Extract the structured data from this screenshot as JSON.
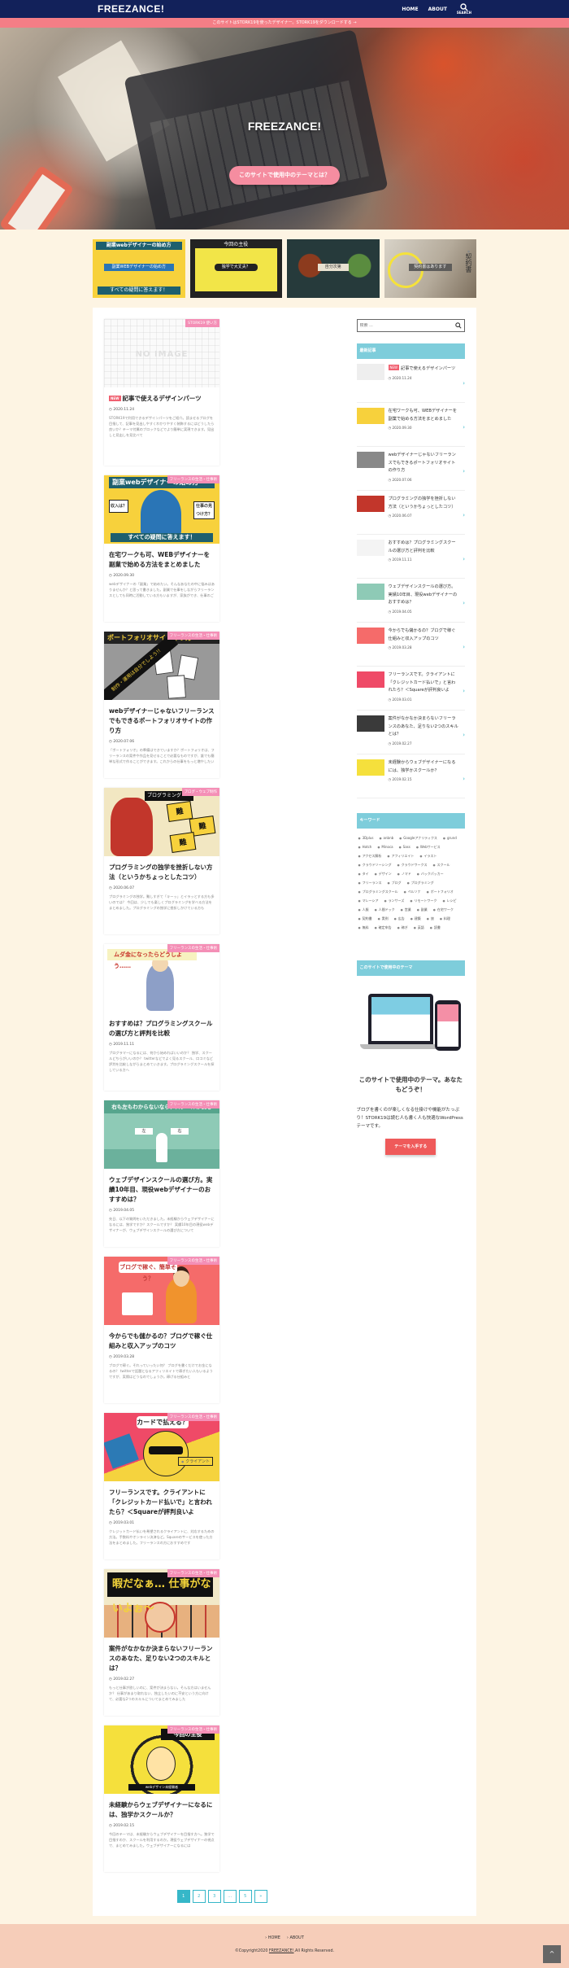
{
  "header": {
    "logo": "FREEZANCE!",
    "nav": [
      "HOME",
      "ABOUT"
    ],
    "search_label": "SEARCH"
  },
  "info_bar": "このサイトはSTORK19を使ったデザイナー。STORK19をダウンロードする →",
  "hero": {
    "title": "FREEZANCE!",
    "button": "このサイトで使用中のテーマとは？"
  },
  "pickup": [
    {
      "line1": "副業webデザイナーの始め方",
      "line2": "副業WEBデザイナーの始め方",
      "line3": "すべての疑問に答えます！"
    },
    {
      "top": "今回の主役",
      "mid": "独学で大丈夫？"
    },
    {
      "mid": "自分次第"
    },
    {
      "mid": "契約書はあります",
      "tag": "契約書"
    }
  ],
  "posts": [
    {
      "category": "STORK19 使い方",
      "new": "NEW",
      "title": "記事で使えるデザインパーツ",
      "date": "2020.11.24",
      "excerpt": "STORK19で利用できるデザインパーツをご紹介。読ませるブログを目指して、記事を見出しやすくわかりやすく装飾するにはどうしたら良いか？テーマ付属のブロックなどでより簡単に実現できます。見出しと見出しを見比べて",
      "thumb_text": "NO IMAGE"
    },
    {
      "category": "フリーランスの生活・仕事術",
      "title": "在宅ワークも可、WEBデザイナーを副業で始める方法をまとめました",
      "date": "2020.09.30",
      "excerpt": "webデザイナーの「副業」で始めたい。そんなあなたの中に悩みはありませんか？と思って書きました。副業で仕事をしながらフリーランスとしても同時に活動している方もいますが、家族ができ、仕事のご",
      "thumb_strip": "副業webデザイナーの始め方",
      "thumb_b1": "収入は？",
      "thumb_b2": "仕事の見つけ方？",
      "thumb_bot": "すべての疑問に答えます！"
    },
    {
      "category": "フリーランスの生活・仕事術",
      "title": "webデザイナーじゃないフリーランスでもできるポートフォリオサイトの作り方",
      "date": "2020.07.06",
      "excerpt": "「ポートフォリオ」の準備はできていますか？ポートフォリオは、フリーランスの案件や作品を見せることで必要なものですが、誰でも簡単な形式で作ることができます。これからの仕事をもっと増やしたい",
      "thumb_strip": "ポートフォリオサイト作り方",
      "thumb_diag": "制作・運用は自分でしよう!!"
    },
    {
      "category": "ブログ・ウェブ制作",
      "title": "プログラミングの独学を挫折しない方法（というかちょっとしたコツ）",
      "date": "2020.06.07",
      "excerpt": "プログラミングの独学。難しすぎて「キーッ」とイラッとする方も多いのでは？ 今回は、少しでも楽しくプログラミングを学べる方法をまとめました。プログラミングの独学に挫折しかけている方も",
      "thumb_strip": "プログラミング",
      "burst": [
        "難",
        "難",
        "難"
      ]
    },
    {
      "category": "フリーランスの生活・仕事術",
      "title": "おすすめは？プログラミングスクールの選び方と評判を比較",
      "date": "2019.11.11",
      "excerpt": "プログラマーになるには、何から始めればいいのか？ 独学、スクールどちらがいいのか？ twitterなどでよく見るスクール、口コミなど評判を比較しながらまとめていきます。プログラミングスクールを探している方へ",
      "thumb_strip": "ムダ金になったらどうしよう……"
    },
    {
      "category": "フリーランスの生活・仕事術",
      "title": "ウェブデザインスクールの選び方。実績10年目、現役webデザイナーのおすすめは？",
      "date": "2019.04.05",
      "excerpt": "先日、以下の質問をいただきました。未経験からウェブデザイナーになるには、独学ですか？スクールですか？ 実績10年目の現役webデザイナーが、ウェブデザインスクールの選び方について",
      "thumb_strip": "右も左もわからないなら、スクールが安心",
      "sign1": "左",
      "sign2": "右"
    },
    {
      "category": "フリーランスの生活・仕事術",
      "title": "今からでも儲かるの？ブログで稼ぐ仕組みと収入アップのコツ",
      "date": "2019.03.28",
      "excerpt": "ブログで稼ぐ。それっていったい何？ ブログを書くだけでお金になるの？ twitterで話題となるアフィリエイトで稼ぎたい人もいるようですが、実際はどうなのでしょうか。稼げる仕組みと",
      "thumb_strip": "ブログで稼ぐ、簡単そう？"
    },
    {
      "category": "フリーランスの生活・仕事術",
      "title": "フリーランスです。クライアントに「クレジットカード払いで」と言われたら？＜Squareが評判良いよ",
      "date": "2019.03.01",
      "excerpt": "クレジットカード払いを希望されるクライアントに、対応するための方法。手数料やオンライン決済など。Squareのサービスを使った方法をまとめました。フリーランスの方におすすめです",
      "thumb_strip": "カードで払える？",
      "thumb_tag": "クライアント"
    },
    {
      "category": "フリーランスの生活・仕事術",
      "title": "案件がなかなか決まらないフリーランスのあなた、足りない2つのスキルとは？",
      "date": "2019.02.27",
      "excerpt": "もっと仕事が欲しいのに、案件が決まらない。そんな方はいませんか？ 仕事があまり取れない、独立したいのに不安という方に向けて、必要な2つのスキルについてまとめてみました",
      "thumb_strip": "暇だなぁ… 仕事がないよぉ～"
    },
    {
      "category": "フリーランスの生活・仕事術",
      "title": "未経験からウェブデザイナーになるには、独学かスクールか？",
      "date": "2019.02.15",
      "excerpt": "今回のテーマは、未経験からウェブデザイナーを目指す方へ。独学で目指すのか、スクールを利用するのか。現役ウェブデザイナーの視点で、まとめてみました。ウェブデザイナーになるには",
      "thumb_strip": "今回の主役",
      "thumb_bar": "webデザイン未経験者"
    }
  ],
  "pagination": [
    "1",
    "2",
    "3",
    "…",
    "5",
    "»"
  ],
  "sidebar": {
    "search_placeholder": "検索 ...",
    "recent_title": "最新記事",
    "recent": [
      {
        "new": "NEW",
        "title": "記事で使えるデザインパーツ",
        "date": "2020.11.24"
      },
      {
        "title": "在宅ワークも可、WEBデザイナーを副業で始める方法をまとめました",
        "date": "2020.09.30"
      },
      {
        "title": "webデザイナーじゃないフリーランスでもできるポートフォリオサイトの作り方",
        "date": "2020.07.06"
      },
      {
        "title": "プログラミングの独学を挫折しない方法（というかちょっとしたコツ）",
        "date": "2020.06.07"
      },
      {
        "title": "おすすめは？プログラミングスクールの選び方と評判を比較",
        "date": "2019.11.11"
      },
      {
        "title": "ウェブデザインスクールの選び方。実績10年目、現役webデザイナーのおすすめは？",
        "date": "2019.04.05"
      },
      {
        "title": "今からでも儲かるの？ブログで稼ぐ仕組みと収入アップのコツ",
        "date": "2019.03.28"
      },
      {
        "title": "フリーランスです。クライアントに「クレジットカード払いで」と言われたら？＜Squareが評判良いよ",
        "date": "2019.03.01"
      },
      {
        "title": "案件がなかなか決まらないフリーランスのあなた、足りない2つのスキルとは？",
        "date": "2019.02.27"
      },
      {
        "title": "未経験からウェブデザイナーになるには、独学かスクールか？",
        "date": "2019.02.15"
      }
    ],
    "keywords_title": "キーワード",
    "tags": [
      "3Dplus",
      "anbnb",
      "Googleアナリティクス",
      "grund",
      "Hotch",
      "Minoca",
      "Sass",
      "Webサービス",
      "アクセス解析",
      "アフィリエイト",
      "イラスト",
      "クラウドソーシング",
      "クラウドワークス",
      "スクール",
      "タイ",
      "デザイン",
      "ノマド",
      "バックパッカー",
      "フリーランス",
      "ブログ",
      "プログラミング",
      "プログラミングスクール",
      "ペルソナ",
      "ポートフォリオ",
      "マレーシア",
      "ランサーズ",
      "リモートワーク",
      "レシピ",
      "人脈",
      "人間ドック",
      "営業",
      "副業",
      "在宅ワーク",
      "契約書",
      "実例",
      "広告",
      "建築",
      "旅",
      "料理",
      "無料",
      "確定申告",
      "稼ぎ",
      "英語",
      "読書"
    ],
    "theme_title": "このサイトで使用中のテーマ",
    "theme_heading": "このサイトで使用中のテーマ。あなたもどうぞ！",
    "theme_text": "ブログを書くのが楽しくなる仕掛けや機能がたっぷり！STORK19は読む人も書く人も快適なWordPressテーマです。",
    "theme_button": "テーマを入手する"
  },
  "footer": {
    "links": [
      "› HOME",
      "› ABOUT"
    ],
    "copyright_prefix": "©Copyright2020 ",
    "copyright_link": "FREEZANCE!",
    "copyright_suffix": ".All Rights Reserved.",
    "totop": "^"
  }
}
